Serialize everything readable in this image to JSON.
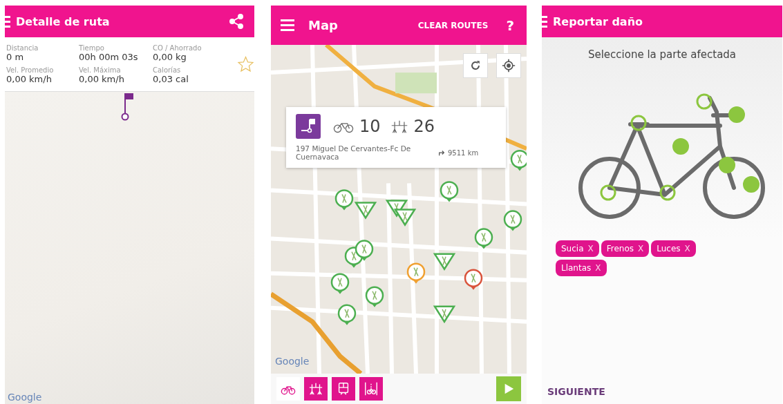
{
  "route_detail": {
    "title": "Detalle de ruta",
    "stats": [
      {
        "label": "Distancia",
        "value": "0 m"
      },
      {
        "label": "Tiempo",
        "value": "00h 00m 03s"
      },
      {
        "label": "CO / Ahorrado",
        "value": "0,00 kg"
      },
      {
        "label": "Vel. Promedio",
        "value": "0,00 km/h"
      },
      {
        "label": "Vel. Máxima",
        "value": "0,00 km/h"
      },
      {
        "label": "Calorías",
        "value": "0,03 cal"
      }
    ],
    "favorite": false,
    "attribution": "Google"
  },
  "map": {
    "title": "Map",
    "action": "CLEAR ROUTES",
    "help": "?",
    "popup": {
      "bikes": "10",
      "docks": "26",
      "address": "197 Miguel De Cervantes-Fc De Cuernavaca",
      "distance": "9511 km"
    },
    "filters": [
      {
        "kind": "bike",
        "selected": false
      },
      {
        "kind": "dock",
        "selected": true
      },
      {
        "kind": "transit",
        "selected": true
      },
      {
        "kind": "lane",
        "selected": true
      }
    ],
    "attribution": "Google"
  },
  "report": {
    "title": "Reportar daño",
    "prompt": "Seleccione la parte afectada",
    "tags": [
      {
        "label": "Sucia",
        "remove": "X"
      },
      {
        "label": "Frenos",
        "remove": "X"
      },
      {
        "label": "Luces",
        "remove": "X"
      },
      {
        "label": "Llantas",
        "remove": "X"
      }
    ],
    "next": "SIGUIENTE"
  }
}
